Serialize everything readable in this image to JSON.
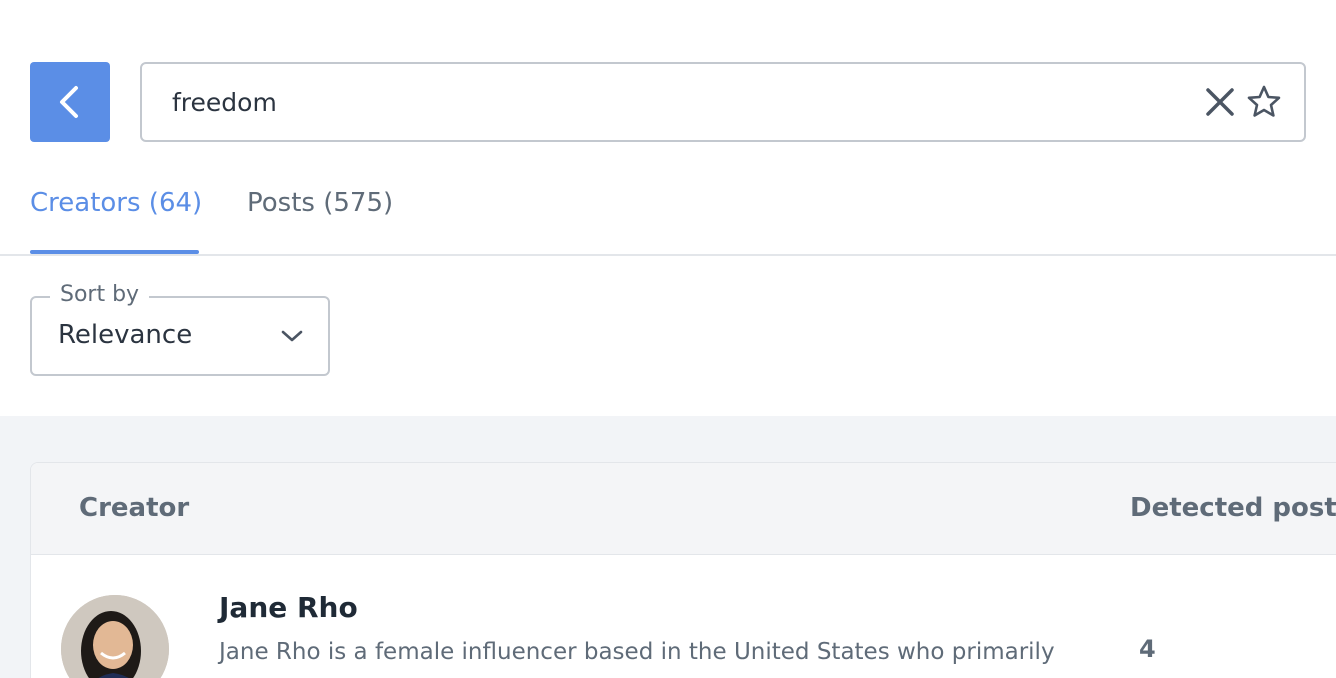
{
  "search": {
    "value": "freedom",
    "clear_icon": "close-icon",
    "favorite_icon": "star-icon"
  },
  "navigation": {
    "back_icon": "chevron-left-icon"
  },
  "tabs": [
    {
      "label": "Creators (64)",
      "active": true
    },
    {
      "label": "Posts (575)",
      "active": false
    }
  ],
  "sort": {
    "label": "Sort by",
    "selected": "Relevance",
    "icon": "chevron-down-icon"
  },
  "table": {
    "columns": [
      "Creator",
      "Detected posts"
    ],
    "rows": [
      {
        "name": "Jane Rho",
        "description": "Jane Rho is a female influencer based in the United States who primarily",
        "detected_posts": "4"
      }
    ]
  },
  "colors": {
    "accent": "#5b8ee6",
    "text_muted": "#5f6b78",
    "background_gray": "#f2f4f7"
  }
}
